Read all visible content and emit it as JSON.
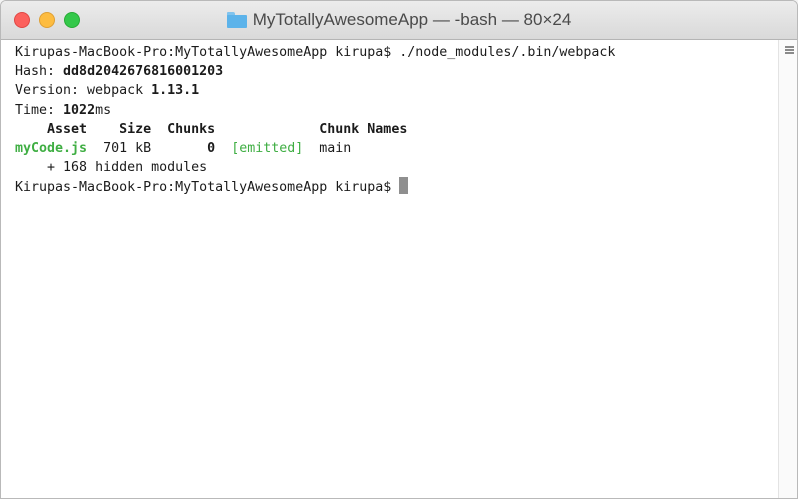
{
  "window": {
    "title": "MyTotallyAwesomeApp — -bash — 80×24",
    "folder_icon": "folder-icon",
    "traffic_lights": {
      "close_color": "#fc615d",
      "minimize_color": "#fdbc40",
      "zoom_color": "#34c84a"
    }
  },
  "terminal": {
    "line1": "Kirupas-MacBook-Pro:MyTotallyAwesomeApp kirupa$ ./node_modules/.bin/webpack",
    "hash_label": "Hash: ",
    "hash_value": "dd8d2042676816001203",
    "version_label": "Version: webpack ",
    "version_value": "1.13.1",
    "time_label": "Time: ",
    "time_value": "1022",
    "time_unit": "ms",
    "table_header": {
      "asset": "Asset",
      "size": "Size",
      "chunks": "Chunks",
      "chunk_names": "Chunk Names"
    },
    "row": {
      "asset": "myCode.js",
      "size": "701 kB",
      "chunks": "0",
      "status": "[emitted]",
      "chunk_name": "main"
    },
    "hidden_modules": "+ 168 hidden modules",
    "prompt": "Kirupas-MacBook-Pro:MyTotallyAwesomeApp kirupa$ ",
    "accent_green": "#3fae43"
  }
}
